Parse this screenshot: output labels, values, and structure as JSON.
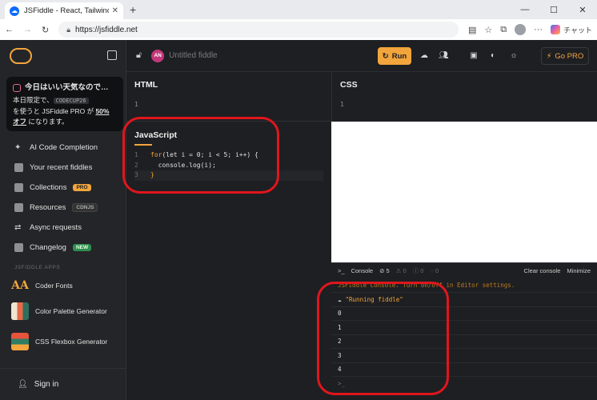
{
  "browser": {
    "tab_title": "JSFiddle - React, Tailwind, and cod",
    "tab_close": "✕",
    "new_tab": "+",
    "url": "https://jsfiddle.net",
    "copilot_label": "チャット",
    "win_min": "—",
    "win_max": "☐",
    "win_close": "✕"
  },
  "topbar": {
    "avatar_initials": "AN",
    "fiddle_title": "Untitled fiddle",
    "run_label": "Run",
    "gopro_label": "Go PRO"
  },
  "promo": {
    "title": "今日はいい天気なので…",
    "line1_pre": "本日限定で、",
    "code": "CODECUP26",
    "line2_pre": "を使うと JSFiddle PRO が ",
    "discount": "50%",
    "line3_bold": "オフ",
    "line3_rest": " になります。"
  },
  "nav": {
    "items": [
      {
        "label": "AI Code Completion",
        "icon": "sparkle-icon"
      },
      {
        "label": "Your recent fiddles",
        "icon": "grid-icon"
      },
      {
        "label": "Collections",
        "icon": "stack-icon",
        "badge": "PRO"
      },
      {
        "label": "Resources",
        "icon": "layers-icon",
        "badge": "CDNJS"
      },
      {
        "label": "Async requests",
        "icon": "swap-icon"
      },
      {
        "label": "Changelog",
        "icon": "doc-icon",
        "badge": "NEW"
      }
    ]
  },
  "apps": {
    "heading": "JSFIDDLE APPS",
    "items": [
      {
        "label": "Coder Fonts"
      },
      {
        "label": "Color Palette Generator"
      },
      {
        "label": "CSS Flexbox Generator"
      }
    ]
  },
  "signin_label": "Sign in",
  "panes": {
    "html_title": "HTML",
    "css_title": "CSS",
    "js_title": "JavaScript",
    "html_line": "1",
    "css_line": "1"
  },
  "js_code": {
    "lines": [
      {
        "n": "1",
        "kw": "for",
        "rest": "(let i = 0; i < 5; i++) {"
      },
      {
        "n": "2",
        "text": "  console.log(i);"
      },
      {
        "n": "3",
        "text": "}"
      }
    ]
  },
  "console": {
    "tab_label": "Console",
    "count_errors": "5",
    "count_warn": "0",
    "count_info": "0",
    "count_log": "0",
    "clear_label": "Clear console",
    "minimize_label": "Minimize",
    "notice": "JSFiddle Console. Turn on/off in Editor settings.",
    "running": "\"Running fiddle\"",
    "outputs": [
      "0",
      "1",
      "2",
      "3",
      "4"
    ],
    "prompt": ">_"
  }
}
